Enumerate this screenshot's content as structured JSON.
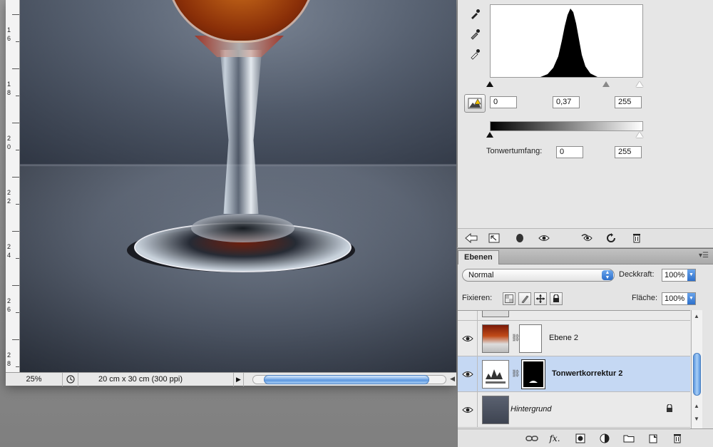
{
  "document": {
    "ruler_numbers": [
      "1",
      "6",
      "1",
      "8",
      "2",
      "0",
      "2",
      "2",
      "2",
      "4",
      "2",
      "6",
      "2",
      "8"
    ],
    "zoom": "25%",
    "doc_size": "20 cm x 30 cm (300 ppi)"
  },
  "levels": {
    "input_black": "0",
    "input_gamma": "0,37",
    "input_white": "255",
    "output_label": "Tonwertumfang:",
    "output_black": "0",
    "output_white": "255"
  },
  "layers_panel": {
    "tab_label": "Ebenen",
    "blend_mode": "Normal",
    "opacity_label": "Deckkraft:",
    "opacity_value": "100%",
    "lock_label": "Fixieren:",
    "fill_label": "Fläche:",
    "fill_value": "100%",
    "layers": [
      {
        "name": "Ebene 2",
        "visible": true,
        "selected": false,
        "bold": false,
        "italic": false
      },
      {
        "name": "Tonwertkorrektur 2",
        "visible": true,
        "selected": true,
        "bold": true,
        "italic": false
      },
      {
        "name": "Hintergrund",
        "visible": true,
        "selected": false,
        "bold": false,
        "italic": true
      }
    ]
  },
  "icons": {
    "eyedroppers": [
      "black-point-eyedropper-icon",
      "gray-point-eyedropper-icon",
      "white-point-eyedropper-icon"
    ],
    "clipping_warning": "clipping-warning-icon",
    "eye": "eye-icon",
    "lock": "lock-icon",
    "link": "link-icon"
  },
  "colors": {
    "selection": "#c5d8f3",
    "accent_blue": "#3a7bd5"
  }
}
